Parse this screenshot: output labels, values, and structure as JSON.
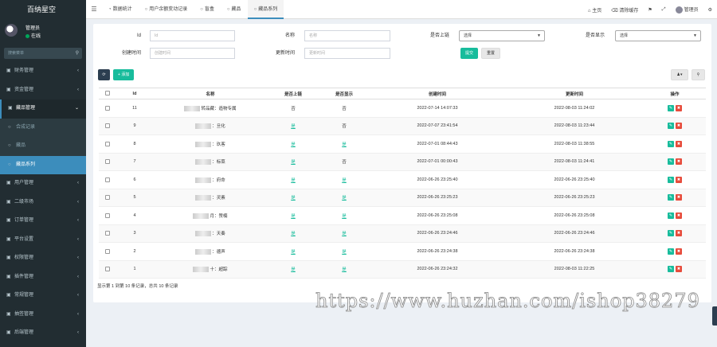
{
  "app": {
    "title": "百纳星空"
  },
  "user": {
    "name": "管理员",
    "status": "在线"
  },
  "search": {
    "placeholder": "搜索菜单"
  },
  "sidebar": {
    "items": [
      {
        "label": "财务管理",
        "icon": "bank-icon"
      },
      {
        "label": "资金管理",
        "icon": "money-icon"
      },
      {
        "label": "藏品管理",
        "icon": "circle-icon",
        "open": true
      }
    ],
    "sub_items": [
      {
        "label": "合成记录"
      },
      {
        "label": "藏品"
      },
      {
        "label": "藏品系列",
        "active": true
      }
    ],
    "items_after": [
      {
        "label": "用户管理",
        "icon": "user-icon"
      },
      {
        "label": "二级市场",
        "icon": "market-icon"
      },
      {
        "label": "订单管理",
        "icon": "order-icon"
      },
      {
        "label": "平台设置",
        "icon": "settings-icon"
      },
      {
        "label": "权限管理",
        "icon": "permission-icon"
      },
      {
        "label": "插件管理",
        "icon": "plugin-icon"
      },
      {
        "label": "常规管理",
        "icon": "general-icon"
      },
      {
        "label": "抽签管理",
        "icon": "lottery-icon"
      },
      {
        "label": "后端管理",
        "icon": "backend-icon"
      }
    ]
  },
  "topbar": {
    "tabs": [
      {
        "label": "数据统计",
        "icon": "dashboard-icon"
      },
      {
        "label": "用户余额变动记录",
        "icon": "circle-icon"
      },
      {
        "label": "盲盒",
        "icon": "circle-icon"
      },
      {
        "label": "藏品",
        "icon": "circle-icon"
      },
      {
        "label": "藏品系列",
        "icon": "circle-icon",
        "active": true
      }
    ],
    "right": {
      "home": "主页",
      "clear_cache": "清除缓存",
      "admin": "管理员"
    }
  },
  "filters": {
    "id_label": "Id",
    "id_placeholder": "Id",
    "name_label": "名称",
    "name_placeholder": "名称",
    "listed_label": "是否上链",
    "listed_value": "选择",
    "shown_label": "是否显示",
    "shown_value": "选择",
    "created_label": "创建时间",
    "created_placeholder": "创建时间",
    "updated_label": "更新时间",
    "updated_placeholder": "更新时间",
    "submit": "提交",
    "reset": "重置"
  },
  "toolbar": {
    "add": "添加"
  },
  "table": {
    "headers": [
      "Id",
      "名称",
      "是否上链",
      "是否显示",
      "创建时间",
      "更新时间",
      "操作"
    ],
    "rows": [
      {
        "id": "11",
        "name": "转品藏：造物专属",
        "listed": "否",
        "shown": "否",
        "created": "2022-07-14 14:07:33",
        "updated": "2022-08-03 11:24:02"
      },
      {
        "id": "9",
        "name": "：旦化",
        "listed": "是",
        "shown": "否",
        "created": "2022-07-07 23:41:54",
        "updated": "2022-08-03 11:23:44"
      },
      {
        "id": "8",
        "name": "：玖客",
        "listed": "是",
        "shown": "是",
        "created": "2022-07-01 08:44:43",
        "updated": "2022-08-03 11:38:55"
      },
      {
        "id": "7",
        "name": "：标菜",
        "listed": "是",
        "shown": "否",
        "created": "2022-07-01 00:00:43",
        "updated": "2022-08-03 11:24:41"
      },
      {
        "id": "6",
        "name": "：府命",
        "listed": "是",
        "shown": "是",
        "created": "2022-06-26 23:25:40",
        "updated": "2022-06-26 23:25:40"
      },
      {
        "id": "5",
        "name": "：灵素",
        "listed": "是",
        "shown": "是",
        "created": "2022-06-26 23:25:23",
        "updated": "2022-06-26 23:25:23"
      },
      {
        "id": "4",
        "name": "月：赞楠",
        "listed": "是",
        "shown": "是",
        "created": "2022-06-26 23:25:08",
        "updated": "2022-06-26 23:25:08"
      },
      {
        "id": "3",
        "name": "：天奏",
        "listed": "是",
        "shown": "是",
        "created": "2022-06-26 23:24:46",
        "updated": "2022-06-26 23:24:46"
      },
      {
        "id": "2",
        "name": "：德声",
        "listed": "是",
        "shown": "是",
        "created": "2022-06-26 23:24:38",
        "updated": "2022-06-26 23:24:38"
      },
      {
        "id": "1",
        "name": "十：超踪",
        "listed": "是",
        "shown": "是",
        "created": "2022-06-26 23:24:32",
        "updated": "2022-08-03 11:22:25"
      }
    ]
  },
  "footer": {
    "summary": "显示第 1 到第 10 条记录，总共 10 条记录"
  },
  "watermark": {
    "text": "https://www.huzhan.com/ishop38279"
  }
}
